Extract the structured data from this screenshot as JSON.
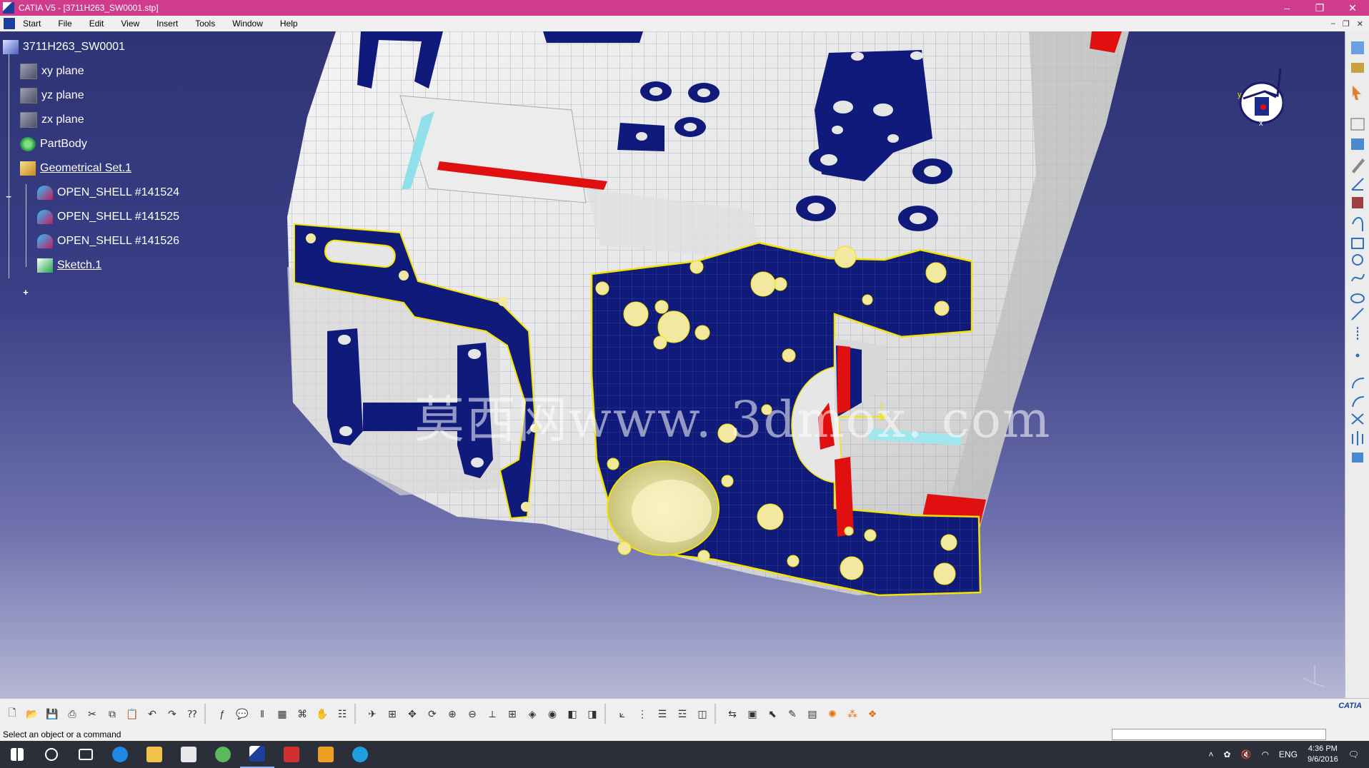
{
  "window": {
    "title": "CATIA V5 - [3711H263_SW0001.stp]",
    "controls": {
      "minimize": "–",
      "restore": "❐",
      "close": "✕"
    }
  },
  "menu": [
    "Start",
    "File",
    "Edit",
    "View",
    "Insert",
    "Tools",
    "Window",
    "Help"
  ],
  "tree": {
    "root": "3711H263_SW0001",
    "items": [
      {
        "label": "xy plane",
        "icon": "plane-icon"
      },
      {
        "label": "yz plane",
        "icon": "plane-icon"
      },
      {
        "label": "zx plane",
        "icon": "plane-icon"
      },
      {
        "label": "PartBody",
        "icon": "partbody-icon"
      },
      {
        "label": "Geometrical Set.1",
        "icon": "geometrical-set-icon"
      },
      {
        "label": "OPEN_SHELL #141524",
        "icon": "open-shell-icon"
      },
      {
        "label": "OPEN_SHELL #141525",
        "icon": "open-shell-icon"
      },
      {
        "label": "OPEN_SHELL #141526",
        "icon": "open-shell-icon"
      },
      {
        "label": "Sketch.1",
        "icon": "sketch-icon"
      }
    ]
  },
  "watermark": "莫西网www. 3dmox. com",
  "compass_labels": {
    "y": "y",
    "x": "x"
  },
  "status": {
    "message": "Select an object or a command"
  },
  "toolbar_brand": "CATIA",
  "taskbar": {
    "language": "ENG",
    "time": "4:36 PM",
    "date": "9/6/2016"
  },
  "colors": {
    "titlebar": "#d13b8c",
    "face_selected": "#101a7a",
    "edge_highlight": "#f2e400",
    "red_face": "#e01010",
    "part_gray": "#e6e6e6"
  }
}
